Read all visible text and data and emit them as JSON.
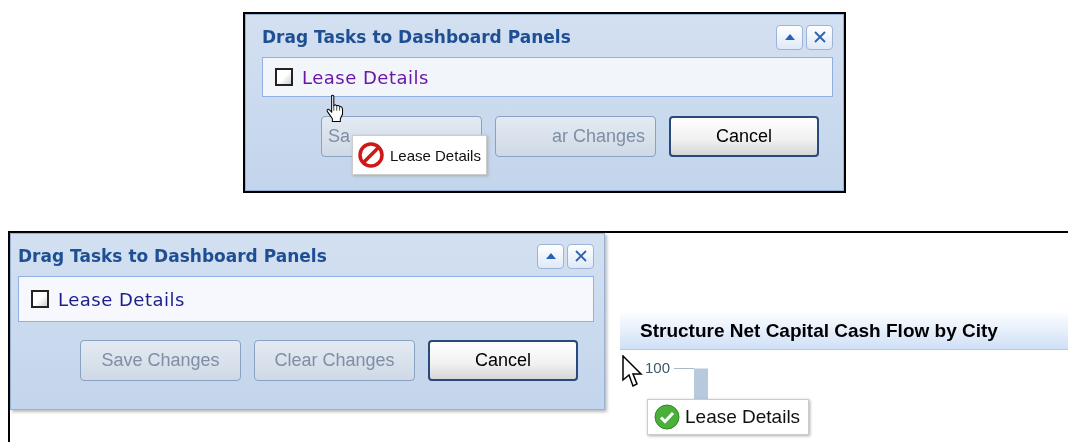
{
  "screens": [
    {
      "dialog": {
        "title": "Drag Tasks to Dashboard Panels",
        "items": [
          {
            "label": "Lease Details",
            "checked": false,
            "hovered": true
          }
        ],
        "buttons": [
          {
            "label": "Sa",
            "disabled": true
          },
          {
            "label": "ar Changes",
            "disabled": true
          },
          {
            "label": "Cancel",
            "disabled": false
          }
        ]
      },
      "drag_proxy": {
        "kind": "denied",
        "label": "Lease Details"
      },
      "pointer": {
        "kind": "hand"
      }
    },
    {
      "dialog": {
        "title": "Drag Tasks to Dashboard Panels",
        "items": [
          {
            "label": "Lease Details",
            "checked": false,
            "hovered": false
          }
        ],
        "buttons": [
          {
            "label": "Save Changes",
            "disabled": true
          },
          {
            "label": "Clear Changes",
            "disabled": true
          },
          {
            "label": "Cancel",
            "disabled": false
          }
        ]
      },
      "chart_panel": {
        "title": "Structure Net Capital Cash Flow by City",
        "axis_label": "100"
      },
      "drag_proxy": {
        "kind": "allowed",
        "label": "Lease Details"
      },
      "pointer": {
        "kind": "arrow"
      }
    }
  ]
}
